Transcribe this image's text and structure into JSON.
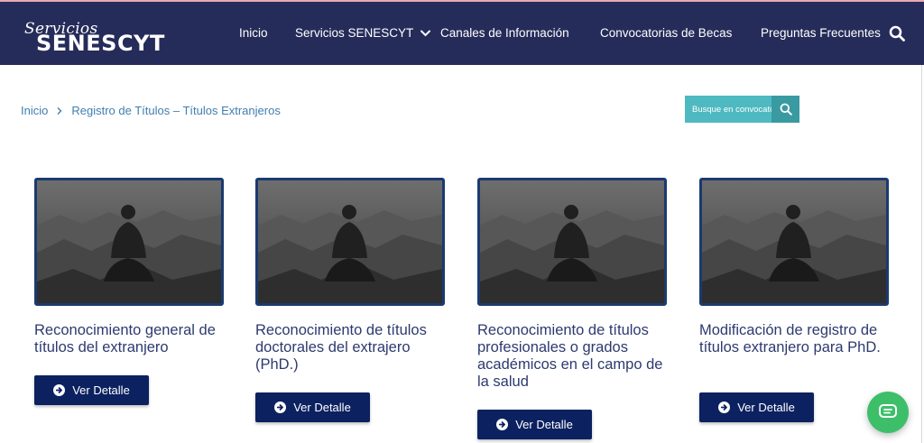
{
  "header": {
    "logo_script": "Servicios",
    "logo_main": "SENESCYT",
    "nav": [
      {
        "label": "Inicio"
      },
      {
        "label": "Servicios SENESCYT"
      },
      {
        "label": "Canales de Información"
      },
      {
        "label": "Convocatorias de Becas"
      },
      {
        "label": "Preguntas Frecuentes"
      }
    ]
  },
  "breadcrumb": {
    "home": "Inicio",
    "current": "Registro de Títulos – Títulos Extranjeros"
  },
  "search": {
    "placeholder": "Busque en convocatorias"
  },
  "cards": [
    {
      "title": "Reconocimiento general de títulos del extranjero",
      "button": "Ver Detalle"
    },
    {
      "title": "Reconocimiento de títulos doctorales del extrajero (PhD.)",
      "button": "Ver Detalle"
    },
    {
      "title": "Reconocimiento de títulos profesionales o grados académicos en el campo de la salud",
      "button": "Ver Detalle"
    },
    {
      "title": "Modificación de registro de títulos extranjero para PhD.",
      "button": "Ver Detalle"
    }
  ],
  "colors": {
    "header_bg": "#262c5a",
    "accent_teal": "#4eb9c0",
    "button_navy": "#0c2160",
    "card_title": "#2d3a70",
    "chat_green": "#3dbf6a"
  },
  "icons": {
    "search": "search-icon",
    "chevron": "chevron-down-icon",
    "arrow": "arrow-circle-right-icon",
    "chat": "chat-icon"
  }
}
